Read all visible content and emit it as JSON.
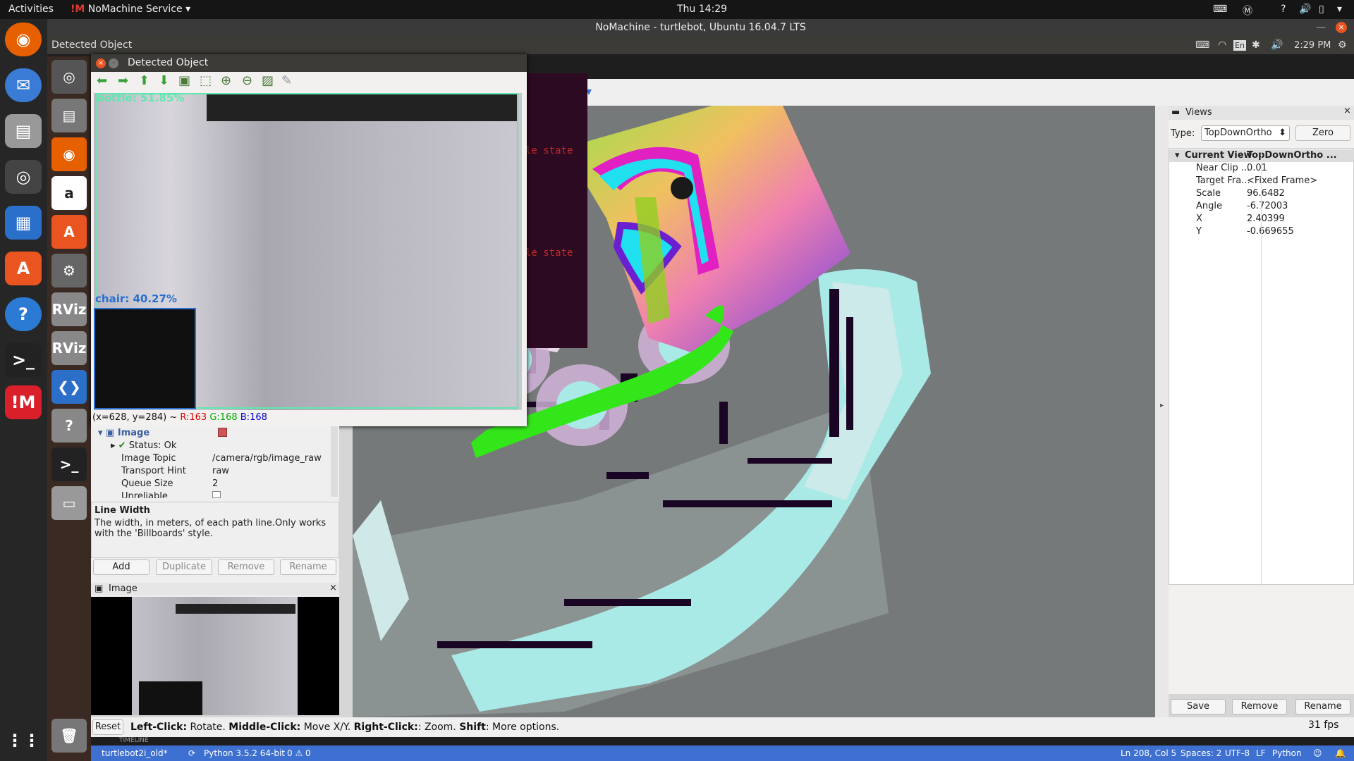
{
  "topbar": {
    "activities": "Activities",
    "app_menu": "NoMachine Service",
    "clock": "Thu 14:29"
  },
  "nomachine": {
    "title": "NoMachine - turtlebot, Ubuntu 16.04.7 LTS"
  },
  "remote_top": {
    "window_label": "Detected Object",
    "time": "2:29 PM",
    "lang": "En"
  },
  "detected": {
    "title": "Detected Object",
    "label_bottle": "bottle: 51.85%",
    "label_chair": "chair: 40.27%",
    "coords": "(x=628, y=284) ~ ",
    "r": "R:163",
    "g": "G:168",
    "b": "B:168"
  },
  "terminal": {
    "line1": "le state",
    "line2": "le state"
  },
  "displays": {
    "image_label": "Image",
    "status": "Status: Ok",
    "props": [
      {
        "k": "Image Topic",
        "v": "/camera/rgb/image_raw"
      },
      {
        "k": "Transport Hint",
        "v": "raw"
      },
      {
        "k": "Queue Size",
        "v": "2"
      },
      {
        "k": "Unreliable",
        "v": ""
      }
    ]
  },
  "help": {
    "title": "Line Width",
    "text": "The width, in meters, of each path line.Only works with the 'Billboards' style."
  },
  "panel_buttons": {
    "add": "Add",
    "duplicate": "Duplicate",
    "remove": "Remove",
    "rename": "Rename"
  },
  "image_panel": {
    "title": "Image"
  },
  "views": {
    "title": "Views",
    "type_label": "Type:",
    "type_value": "TopDownOrtho",
    "zero": "Zero",
    "props": [
      {
        "k": "Current View",
        "v": "TopDownOrtho ..."
      },
      {
        "k": "Near Clip ...",
        "v": "0.01"
      },
      {
        "k": "Target Fra...",
        "v": "<Fixed Frame>"
      },
      {
        "k": "Scale",
        "v": "96.6482"
      },
      {
        "k": "Angle",
        "v": "-6.72003"
      },
      {
        "k": "X",
        "v": "2.40399"
      },
      {
        "k": "Y",
        "v": "-0.669655"
      }
    ],
    "save": "Save",
    "remove": "Remove",
    "rename": "Rename"
  },
  "status": {
    "reset": "Reset",
    "left": "Left-Click:",
    "left_t": " Rotate. ",
    "middle": "Middle-Click:",
    "middle_t": " Move X/Y. ",
    "right": "Right-Click:",
    "right_t": ": Zoom. ",
    "shift": "Shift",
    "shift_t": ": More options.",
    "fps": "31 fps",
    "timeline": "TIMELINE"
  },
  "vscode": {
    "branch": "turtlebot2i_old*",
    "python": "Python 3.5.2 64-bit",
    "problems": "0 ⚠ 0",
    "pos": "Ln 208, Col 5",
    "spaces": "Spaces: 2",
    "enc": "UTF-8",
    "eol": "LF",
    "lang": "Python"
  },
  "colors": {
    "accent": "#e95420",
    "vscode_blue": "#3e70d1",
    "path_green": "#2ee600"
  }
}
